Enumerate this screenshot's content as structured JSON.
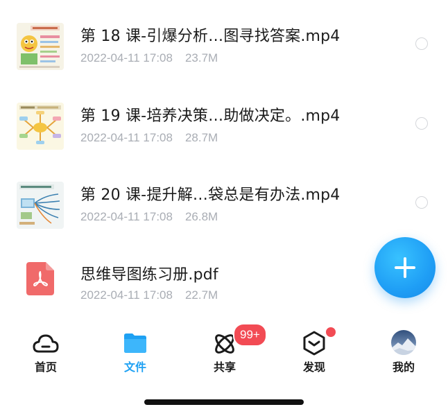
{
  "files": [
    {
      "name": "第 18 课-引爆分析…图寻找答案.mp4",
      "date": "2022-04-11 17:08",
      "size": "23.7M",
      "thumbnail": "mindmap-thumbnail-cartoon"
    },
    {
      "name": "第 19 课-培养决策…助做决定。.mp4",
      "date": "2022-04-11 17:08",
      "size": "28.7M",
      "thumbnail": "mindmap-thumbnail-yellow"
    },
    {
      "name": "第 20 课-提升解…袋总是有办法.mp4",
      "date": "2022-04-11 17:08",
      "size": "26.8M",
      "thumbnail": "mindmap-thumbnail-blue"
    },
    {
      "name": "思维导图练习册.pdf",
      "date": "2022-04-11 17:08",
      "size": "22.7M",
      "thumbnail": "pdf-icon"
    }
  ],
  "fab": {
    "icon": "plus-icon",
    "color": "#1f9ef5"
  },
  "tabs": [
    {
      "label": "首页",
      "icon": "cloud-icon"
    },
    {
      "label": "文件",
      "icon": "folder-icon",
      "active": true
    },
    {
      "label": "共享",
      "icon": "orbit-icon"
    },
    {
      "label": "发现",
      "icon": "cube-icon"
    },
    {
      "label": "我的",
      "icon": "avatar-icon"
    }
  ],
  "badges": {
    "share_count": "99+"
  },
  "colors": {
    "accent": "#1ea1f3",
    "badge": "#f24b54",
    "pdf": "#f06a6a"
  }
}
